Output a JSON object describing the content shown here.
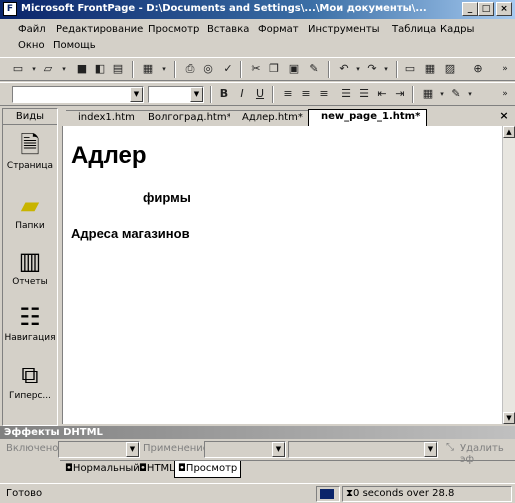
{
  "titlebar": {
    "title": "Microsoft FrontPage - D:\\Documents and Settings\\...\\Мои документы\\...",
    "app_icon": "frontpage-icon"
  },
  "menu": {
    "row1": [
      "Файл",
      "Редактирование",
      "Просмотр",
      "Вставка",
      "Формат",
      "Инструменты",
      "Таблица",
      "Кадры"
    ],
    "row2": [
      "Окно",
      "Помощь"
    ]
  },
  "views": {
    "header": "Виды",
    "items": [
      {
        "label": "Страница",
        "icon": "page-view-icon"
      },
      {
        "label": "Папки",
        "icon": "folder-icon"
      },
      {
        "label": "Отчеты",
        "icon": "reports-icon"
      },
      {
        "label": "Навигация",
        "icon": "navigation-icon"
      },
      {
        "label": "Гиперс...",
        "icon": "hyperlinks-icon"
      }
    ]
  },
  "tabs": [
    {
      "label": "index1.htm"
    },
    {
      "label": "Волгоград.htm*"
    },
    {
      "label": "Адлер.htm*"
    },
    {
      "label": "new_page_1.htm*",
      "active": true
    }
  ],
  "document": {
    "heading": "Адлер",
    "firms": "фирмы",
    "stores": "Адреса магазинов"
  },
  "dhtml": {
    "title": "Эффекты DHTML",
    "enable_label": "Включено",
    "apply_label": "Применение",
    "remove_label": "Удалить эф"
  },
  "modes": [
    {
      "label": "Нормальный"
    },
    {
      "label": "HTML"
    },
    {
      "label": "Просмотр",
      "active": true
    }
  ],
  "status": {
    "ready": "Готово",
    "timing": "0 seconds over 28.8"
  },
  "colors": {
    "title_start": "#0a246a",
    "title_end": "#a6caf0",
    "face": "#d4d0c8"
  }
}
